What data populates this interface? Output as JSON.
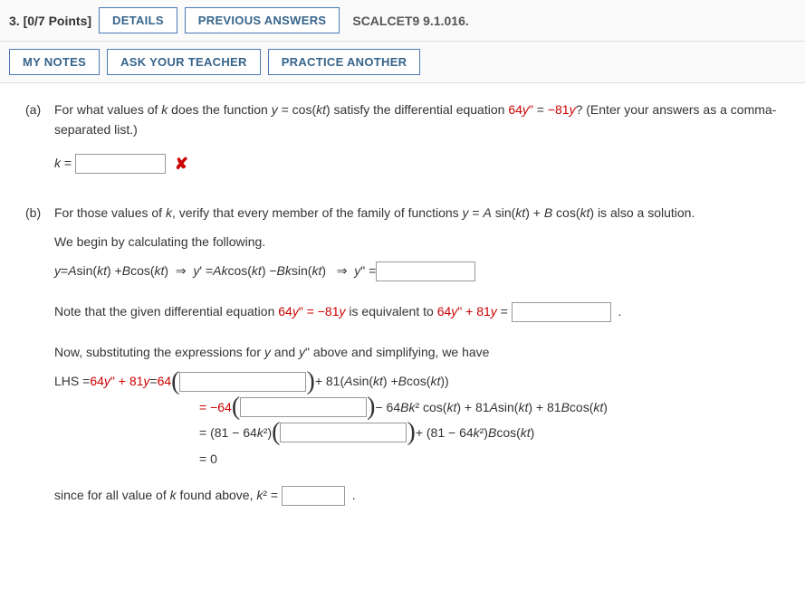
{
  "header": {
    "qnum": "3.",
    "points": "[0/7 Points]",
    "details": "DETAILS",
    "previous": "PREVIOUS ANSWERS",
    "assign": "SCALCET9 9.1.016.",
    "mynotes": "MY NOTES",
    "ask": "ASK YOUR TEACHER",
    "practice": "PRACTICE ANOTHER"
  },
  "a": {
    "label": "(a)",
    "q1": "For what values of ",
    "q2": " does the function ",
    "q3": " = cos(",
    "q4": ") satisfy the differential equation ",
    "de1": "64",
    "de2": " = ",
    "de3": "−81",
    "q5": "? (Enter your answers as a comma-separated list.)",
    "keq": " = "
  },
  "b": {
    "label": "(b)",
    "q": "For those values of ",
    "q2": ", verify that every member of the family of functions ",
    "q3": " = ",
    "q4": " sin(",
    "q5": ") + ",
    "q6": " cos(",
    "q7": ") is also a solution.",
    "begin": "We begin by calculating the following.",
    "ydef1": " sin(",
    "ydef2": ") + ",
    "ydef3": " cos(",
    "ydef4": ")",
    "implies": "⇒",
    "yp1": "' = ",
    "yp2": " cos(",
    "yp3": ") − ",
    "yp4": " sin(",
    "ypp": "\" = ",
    "note1": "Note that the given differential equation ",
    "note2": "64",
    "note3": "\" = −81",
    "note4": " is equivalent to ",
    "note5": "64",
    "note6": "\" + 81",
    "note7": " = ",
    "now": "Now, substituting the expressions for ",
    "now2": " and ",
    "now3": "\" above and simplifying, we have",
    "lhs": "LHS = ",
    "l64a": "64",
    "l64b": "\" + 81",
    "eq64": " = ",
    "c64": "64",
    "p81": " + 81(",
    "p81b": " sin(",
    "p81c": ") + ",
    "p81d": " cos(",
    "p81e": "))",
    "eqn64": "= −64",
    "minus64b": " − 64",
    "bk2": "² cos(",
    "plus81a": ") + 81",
    "sin": " sin(",
    "plus81b": ") + 81",
    "cos": " cos(",
    "eq81m": "= (81 − 64",
    "k2a": "²)",
    "plus81m": " + (81 − 64",
    "k2b": "²) ",
    "bcos": " cos(",
    "eq0": "= 0",
    "since": "since for all value of ",
    "since2": " found above, ",
    "k2eq": "² = "
  },
  "vars": {
    "k": "k",
    "y": "y",
    "kt": "kt",
    "A": "A",
    "B": "B",
    "Ak": "Ak",
    "Bk": "Bk"
  }
}
